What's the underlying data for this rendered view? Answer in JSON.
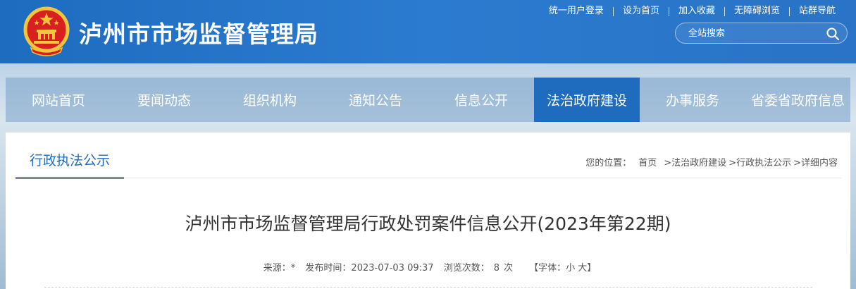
{
  "header": {
    "site_title": "泸州市市场监督管理局",
    "top_links": [
      "统一用户登录",
      "设为首页",
      "加入收藏",
      "无障碍浏览",
      "站群导航"
    ],
    "search_placeholder": "全站搜索",
    "brand_color": "#2a78c8"
  },
  "nav": {
    "items": [
      "网站首页",
      "要闻动态",
      "组织机构",
      "通知公告",
      "信息公开",
      "法治政府建设",
      "办事服务",
      "省委省政府信息"
    ],
    "active_index": 5
  },
  "section": {
    "title": "行政执法公示",
    "breadcrumb": {
      "label": "您的位置：",
      "items": [
        "首页",
        ">法治政府建设",
        ">行政执法公示",
        ">详细内容"
      ]
    }
  },
  "article": {
    "title": "泸州市市场监督管理局行政处罚案件信息公开(2023年第22期)",
    "source_label": "来源：*",
    "publish_label": "发布时间：2023-07-03 09:37",
    "views_label": "浏览次数：",
    "views_count": "8",
    "views_unit": "次",
    "font_label_prefix": "【字体：",
    "font_small": "小",
    "font_large": "大",
    "font_label_suffix": "】"
  }
}
